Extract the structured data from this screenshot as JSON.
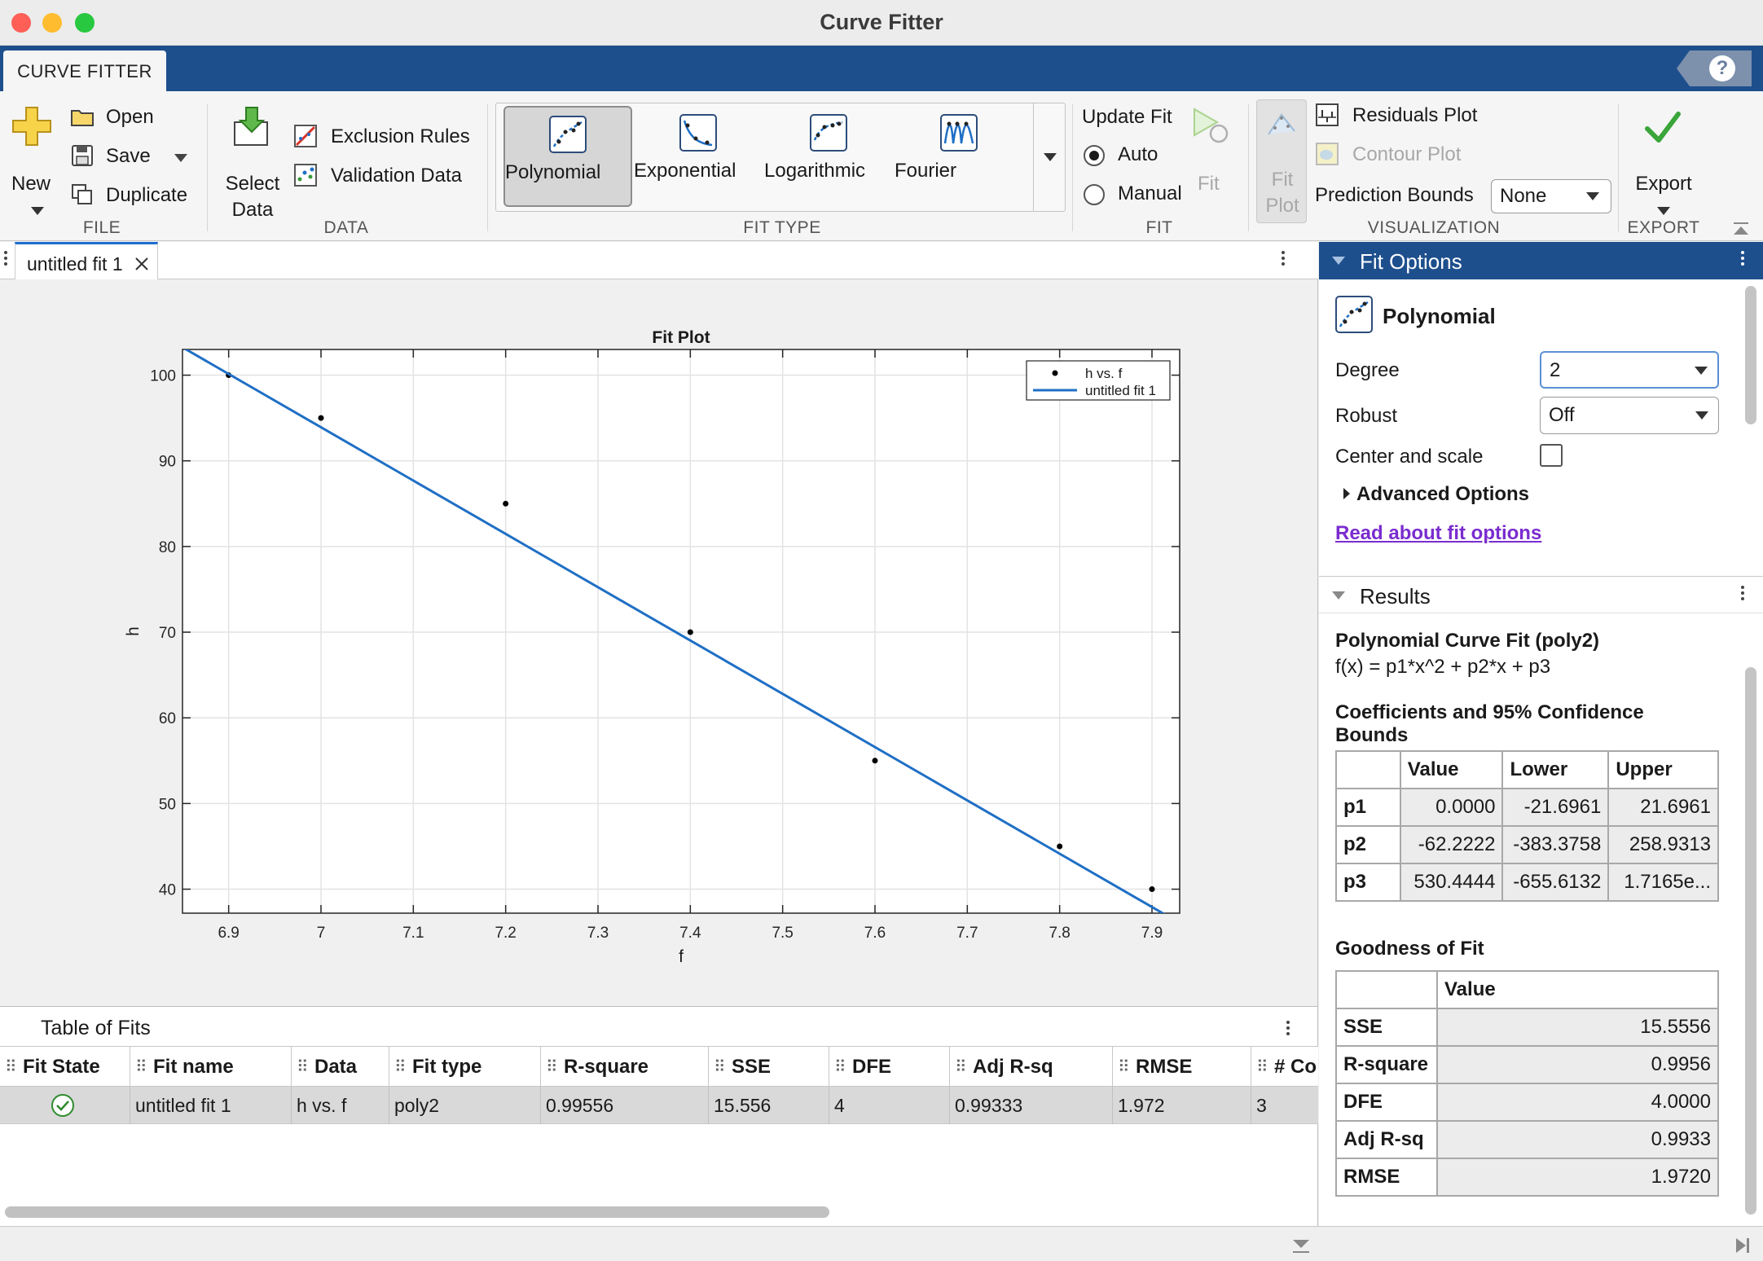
{
  "window": {
    "title": "Curve Fitter"
  },
  "tabs": {
    "main": "CURVE FITTER",
    "help": "?"
  },
  "file": {
    "new": "New",
    "open": "Open",
    "save": "Save",
    "duplicate": "Duplicate",
    "section": "FILE"
  },
  "data": {
    "select_line1": "Select",
    "select_line2": "Data",
    "exclusion": "Exclusion Rules",
    "validation": "Validation Data",
    "section": "DATA"
  },
  "fittype": {
    "items": [
      "Polynomial",
      "Exponential",
      "Logarithmic",
      "Fourier"
    ],
    "selected": "Polynomial",
    "section": "FIT TYPE"
  },
  "fit": {
    "update_fit": "Update Fit",
    "auto": "Auto",
    "manual": "Manual",
    "auto_selected": true,
    "fit_btn": "Fit",
    "section": "FIT"
  },
  "visualization": {
    "fitplot_line1": "Fit",
    "fitplot_line2": "Plot",
    "residuals": "Residuals Plot",
    "contour": "Contour Plot",
    "pred_bounds_label": "Prediction Bounds",
    "pred_bounds_value": "None",
    "section": "VISUALIZATION"
  },
  "export": {
    "label": "Export",
    "section": "EXPORT"
  },
  "document": {
    "tab": "untitled fit 1"
  },
  "chart_data": {
    "type": "scatter",
    "title": "Fit Plot",
    "xlabel": "f",
    "ylabel": "h",
    "xlim": [
      6.85,
      7.93
    ],
    "ylim": [
      37.2,
      103.0
    ],
    "xticks": [
      "6.9",
      "7",
      "7.1",
      "7.2",
      "7.3",
      "7.4",
      "7.5",
      "7.6",
      "7.7",
      "7.8",
      "7.9"
    ],
    "yticks": [
      "40",
      "50",
      "60",
      "70",
      "80",
      "90",
      "100"
    ],
    "grid": true,
    "legend": "top-right",
    "series": [
      {
        "name": "h vs. f",
        "kind": "points",
        "color": "#000000",
        "x": [
          6.9,
          7.0,
          7.2,
          7.4,
          7.6,
          7.8,
          7.9
        ],
        "y": [
          100,
          95,
          85,
          70,
          55,
          45,
          40
        ]
      },
      {
        "name": "untitled fit 1",
        "kind": "line",
        "color": "#1f6fc5",
        "x": [
          6.85,
          7.93
        ],
        "y": [
          103.25,
          36.05
        ]
      }
    ]
  },
  "table_of_fits": {
    "title": "Table of Fits",
    "columns": [
      "Fit State",
      "Fit name",
      "Data",
      "Fit type",
      "R-square",
      "SSE",
      "DFE",
      "Adj R-sq",
      "RMSE",
      "# Co"
    ],
    "rows": [
      [
        "",
        "untitled fit 1",
        "h vs. f",
        "poly2",
        "0.99556",
        "15.556",
        "4",
        "0.99333",
        "1.972",
        "3"
      ]
    ]
  },
  "fit_options": {
    "header": "Fit Options",
    "type": "Polynomial",
    "degree_label": "Degree",
    "degree_value": "2",
    "robust_label": "Robust",
    "robust_value": "Off",
    "center_label": "Center and scale",
    "advanced": "Advanced Options",
    "read_link": "Read about fit options"
  },
  "results": {
    "header": "Results",
    "fit_title": "Polynomial Curve Fit (poly2)",
    "equation": "f(x) = p1*x^2 + p2*x + p3",
    "coef_title_1": "Coefficients and 95% Confidence",
    "coef_title_2": "Bounds",
    "coef_cols": [
      "Value",
      "Lower",
      "Upper"
    ],
    "coef_rows": [
      [
        "p1",
        "0.0000",
        "-21.6961",
        "21.6961"
      ],
      [
        "p2",
        "-62.2222",
        "-383.3758",
        "258.9313"
      ],
      [
        "p3",
        "530.4444",
        "-655.6132",
        "1.7165e..."
      ]
    ],
    "gof_title": "Goodness of Fit",
    "gof_col": "Value",
    "gof_rows": [
      [
        "SSE",
        "15.5556"
      ],
      [
        "R-square",
        "0.9956"
      ],
      [
        "DFE",
        "4.0000"
      ],
      [
        "Adj R-sq",
        "0.9933"
      ],
      [
        "RMSE",
        "1.9720"
      ]
    ]
  }
}
